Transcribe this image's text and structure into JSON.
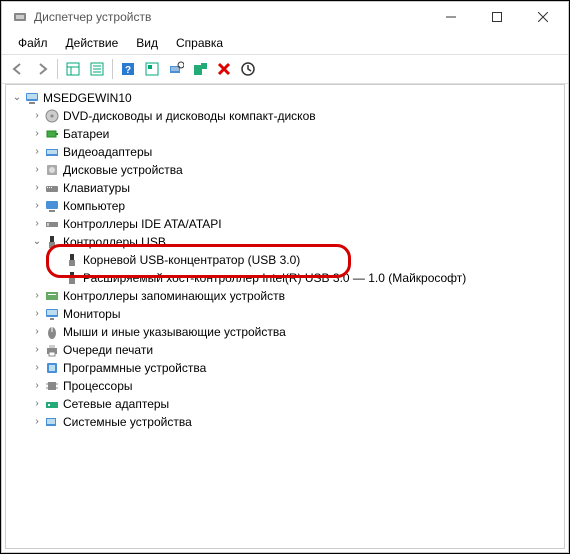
{
  "window": {
    "title": "Диспетчер устройств"
  },
  "menu": {
    "file": "Файл",
    "action": "Действие",
    "view": "Вид",
    "help": "Справка"
  },
  "tree": {
    "root": "MSEDGEWIN10",
    "dvd": "DVD-дисководы и дисководы компакт-дисков",
    "batteries": "Батареи",
    "display": "Видеоадаптеры",
    "disk": "Дисковые устройства",
    "keyboard": "Клавиатуры",
    "computer": "Компьютер",
    "ide": "Контроллеры IDE ATA/ATAPI",
    "usb_ctrl": "Контроллеры USB",
    "usb_root_hub": "Корневой USB-концентратор (USB 3.0)",
    "usb_xhci": "Расширяемый хост-контроллер Intel(R) USB 3.0 — 1.0 (Майкрософт)",
    "storage_ctrl": "Контроллеры запоминающих устройств",
    "monitors": "Мониторы",
    "mice": "Мыши и иные указывающие устройства",
    "print": "Очереди печати",
    "software": "Программные устройства",
    "cpu": "Процессоры",
    "network": "Сетевые адаптеры",
    "system": "Системные устройства"
  }
}
